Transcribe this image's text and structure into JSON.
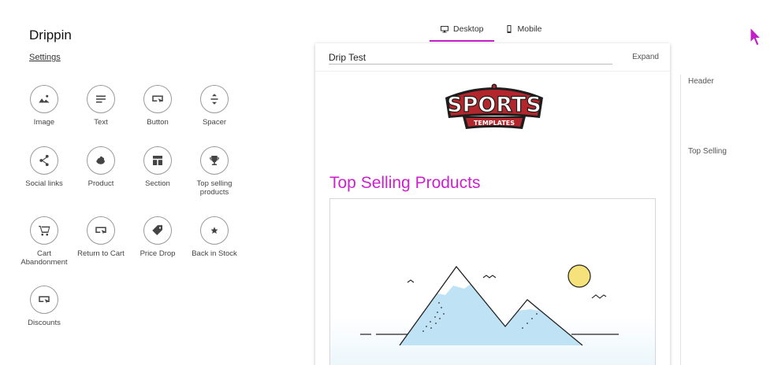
{
  "app": {
    "title": "Drippin",
    "settings_label": "Settings"
  },
  "palette": [
    {
      "label": "Image",
      "icon": "image-icon"
    },
    {
      "label": "Text",
      "icon": "text-icon"
    },
    {
      "label": "Button",
      "icon": "button-icon"
    },
    {
      "label": "Spacer",
      "icon": "spacer-icon"
    },
    {
      "label": "Social links",
      "icon": "share-icon"
    },
    {
      "label": "Product",
      "icon": "product-icon"
    },
    {
      "label": "Section",
      "icon": "section-icon"
    },
    {
      "label": "Top selling products",
      "icon": "trophy-icon"
    },
    {
      "label": "Cart Abandonment",
      "icon": "cart-icon"
    },
    {
      "label": "Return to Cart",
      "icon": "return-cart-icon"
    },
    {
      "label": "Price Drop",
      "icon": "tag-icon"
    },
    {
      "label": "Back in Stock",
      "icon": "star-icon"
    },
    {
      "label": "Discounts",
      "icon": "discount-icon"
    }
  ],
  "tabs": [
    {
      "label": "Desktop",
      "icon": "desktop-icon",
      "active": true
    },
    {
      "label": "Mobile",
      "icon": "mobile-icon",
      "active": false
    }
  ],
  "editor": {
    "email_name": "Drip Test",
    "expand_label": "Expand",
    "logo": {
      "top": "SPORTS",
      "bottom": "TEMPLATES"
    },
    "heading": "Top Selling Products"
  },
  "outline": [
    "Header",
    "Top Selling"
  ],
  "colors": {
    "accent": "#c21fcb",
    "heading": "#cc22cc",
    "logo_red": "#b3262c",
    "sun": "#f6e27a",
    "mountain": "#bfe3f5"
  }
}
